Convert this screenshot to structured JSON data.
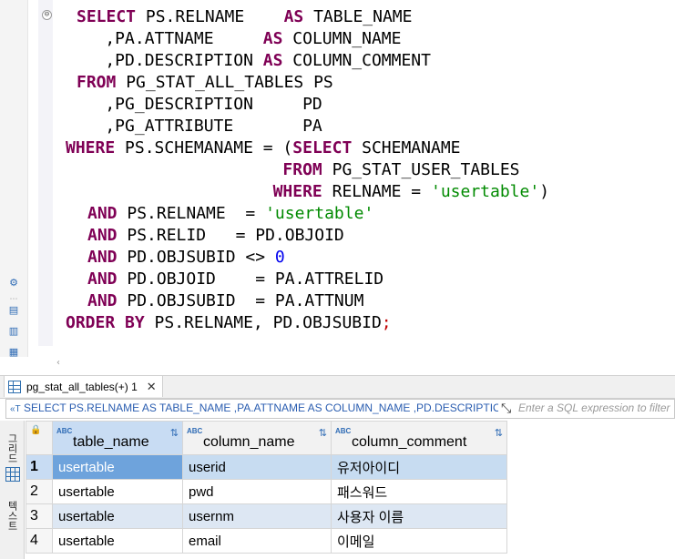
{
  "editor": {
    "lines": [
      [
        {
          "t": "SELECT ",
          "c": "kw"
        },
        {
          "t": "PS.RELNAME    "
        },
        {
          "t": "AS ",
          "c": "kw"
        },
        {
          "t": "TABLE_NAME"
        }
      ],
      [
        {
          "t": "    ,PA.ATTNAME     "
        },
        {
          "t": "AS ",
          "c": "kw"
        },
        {
          "t": "COLUMN_NAME"
        }
      ],
      [
        {
          "t": "    ,PD.DESCRIPTION "
        },
        {
          "t": "AS ",
          "c": "kw"
        },
        {
          "t": "COLUMN_COMMENT"
        }
      ],
      [
        {
          "t": "FROM ",
          "c": "kw"
        },
        {
          "t": "PG_STAT_ALL_TABLES PS"
        }
      ],
      [
        {
          "t": "    ,PG_DESCRIPTION     PD"
        }
      ],
      [
        {
          "t": "    ,PG_ATTRIBUTE       PA"
        }
      ],
      [
        {
          "t": "WHERE ",
          "c": "kw"
        },
        {
          "t": "PS.SCHEMANAME = ("
        },
        {
          "t": "SELECT ",
          "c": "kw"
        },
        {
          "t": "SCHEMANAME"
        }
      ],
      [
        {
          "t": "                      "
        },
        {
          "t": "FROM ",
          "c": "kw"
        },
        {
          "t": "PG_STAT_USER_TABLES"
        }
      ],
      [
        {
          "t": "                     "
        },
        {
          "t": "WHERE ",
          "c": "kw"
        },
        {
          "t": "RELNAME = "
        },
        {
          "t": "'usertable'",
          "c": "str"
        },
        {
          "t": ")"
        }
      ],
      [
        {
          "t": "AND ",
          "c": "kw"
        },
        {
          "t": "PS.RELNAME  = "
        },
        {
          "t": "'usertable'",
          "c": "str"
        }
      ],
      [
        {
          "t": "AND ",
          "c": "kw"
        },
        {
          "t": "PS.RELID   = PD.OBJOID"
        }
      ],
      [
        {
          "t": "AND ",
          "c": "kw"
        },
        {
          "t": "PD.OBJSUBID <> "
        },
        {
          "t": "0",
          "c": "num"
        }
      ],
      [
        {
          "t": "AND ",
          "c": "kw"
        },
        {
          "t": "PD.OBJOID    = PA.ATTRELID"
        }
      ],
      [
        {
          "t": "AND ",
          "c": "kw"
        },
        {
          "t": "PD.OBJSUBID  = PA.ATTNUM"
        }
      ],
      [
        {
          "t": "ORDER BY ",
          "c": "kw"
        },
        {
          "t": "PS.RELNAME, PD.OBJSUBID"
        },
        {
          "t": ";",
          "c": "semi"
        }
      ]
    ],
    "indents": [
      1,
      0,
      0,
      1,
      0,
      0,
      0,
      0,
      0,
      2,
      2,
      2,
      2,
      2,
      0
    ],
    "fold_marker": "⊖",
    "scroll_arrow": "‹"
  },
  "result_tab": {
    "label": "pg_stat_all_tables(+) 1",
    "close": "✕"
  },
  "filter": {
    "query": "SELECT PS.RELNAME AS TABLE_NAME ,PA.ATTNAME AS COLUMN_NAME ,PD.DESCRIPTION AS COLUMN_COMMENT",
    "placeholder": "Enter a SQL expression to filter results (use Ctrl+Space)"
  },
  "sidebar": {
    "tab_grid": "그리드",
    "tab_text": "텍스트"
  },
  "grid": {
    "type_badge": "ABC",
    "sort_icon": "⇅",
    "columns": [
      "table_name",
      "column_name",
      "column_comment"
    ],
    "rows": [
      {
        "n": "1",
        "table_name": "usertable",
        "column_name": "userid",
        "column_comment": "유저아이디"
      },
      {
        "n": "2",
        "table_name": "usertable",
        "column_name": "pwd",
        "column_comment": "패스워드"
      },
      {
        "n": "3",
        "table_name": "usertable",
        "column_name": "usernm",
        "column_comment": "사용자 이름"
      },
      {
        "n": "4",
        "table_name": "usertable",
        "column_name": "email",
        "column_comment": "이메일"
      }
    ]
  },
  "colors": {
    "keyword": "#7f0055",
    "string": "#008a00",
    "number": "#0000ee",
    "selection": "#6ea3dc"
  }
}
